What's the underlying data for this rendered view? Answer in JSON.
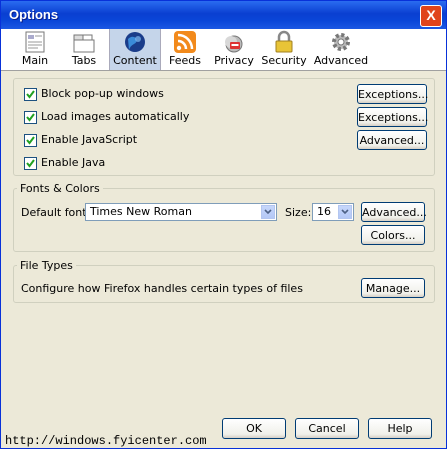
{
  "window": {
    "title": "Options",
    "close_glyph": "X"
  },
  "tabs": [
    {
      "label": "Main",
      "icon": "main-icon"
    },
    {
      "label": "Tabs",
      "icon": "tabs-icon"
    },
    {
      "label": "Content",
      "icon": "content-icon",
      "selected": true
    },
    {
      "label": "Feeds",
      "icon": "feeds-icon"
    },
    {
      "label": "Privacy",
      "icon": "privacy-icon"
    },
    {
      "label": "Security",
      "icon": "security-icon"
    },
    {
      "label": "Advanced",
      "icon": "advanced-icon"
    }
  ],
  "content": {
    "options": [
      {
        "label": "Block pop-up windows",
        "checked": true,
        "button": "Exceptions..."
      },
      {
        "label": "Load images automatically",
        "checked": true,
        "button": "Exceptions..."
      },
      {
        "label": "Enable JavaScript",
        "checked": true,
        "button": "Advanced..."
      },
      {
        "label": "Enable Java",
        "checked": true
      }
    ]
  },
  "fonts": {
    "group_label": "Fonts & Colors",
    "default_font_label": "Default font:",
    "default_font_value": "Times New Roman",
    "size_label": "Size:",
    "size_value": "16",
    "advanced_button": "Advanced...",
    "colors_button": "Colors..."
  },
  "filetypes": {
    "group_label": "File Types",
    "description": "Configure how Firefox handles certain types of files",
    "manage_button": "Manage..."
  },
  "footer": {
    "ok": "OK",
    "cancel": "Cancel",
    "help": "Help"
  },
  "watermark": "http://windows.fyicenter.com",
  "colors": {
    "titlebar": "#0a46d8",
    "background": "#ece9d8",
    "selected_tab": "#c5d5ea"
  }
}
